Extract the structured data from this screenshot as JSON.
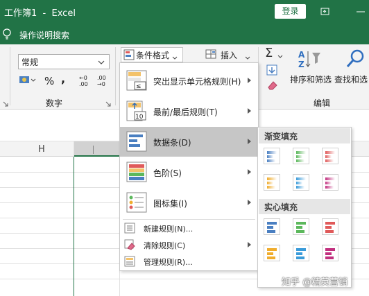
{
  "titlebar": {
    "title": "工作簿1  -  Excel",
    "login_label": "登录"
  },
  "tellme": {
    "text": "操作说明搜索"
  },
  "ribbon": {
    "number_format_value": "常规",
    "percent_symbol": "%",
    "comma_symbol": ",",
    "number_group_label": "数字",
    "conditional_format_label": "条件格式",
    "insert_label": "插入",
    "sort_filter_label": "排序和筛选",
    "find_select_label": "查找和选",
    "edit_group_label": "编辑",
    "sum_symbol": "Σ"
  },
  "sheet": {
    "column_h": "H"
  },
  "cf_menu": {
    "items": [
      {
        "label": "突出显示单元格规则(H)"
      },
      {
        "label": "最前/最后规则(T)"
      },
      {
        "label": "数据条(D)"
      },
      {
        "label": "色阶(S)"
      },
      {
        "label": "图标集(I)"
      }
    ],
    "small_items": [
      {
        "label": "新建规则(N)..."
      },
      {
        "label": "清除规则(C)"
      },
      {
        "label": "管理规则(R)..."
      }
    ]
  },
  "databar_menu": {
    "gradient_header": "渐变填充",
    "solid_header": "实心填充",
    "gradient_colors": [
      "#4a7fc1",
      "#5cb85c",
      "#e05a5a",
      "#f0ad2e",
      "#3a9bd9",
      "#c2307f"
    ],
    "solid_colors": [
      "#4a7fc1",
      "#5cb85c",
      "#e05a5a",
      "#f0ad2e",
      "#3a9bd9",
      "#c2307f"
    ]
  },
  "watermark": "知乎 @精英营销",
  "colors": {
    "accent": "#217346",
    "ribbon_bg": "#f3f3f3",
    "selected": "#c6c6c6"
  }
}
